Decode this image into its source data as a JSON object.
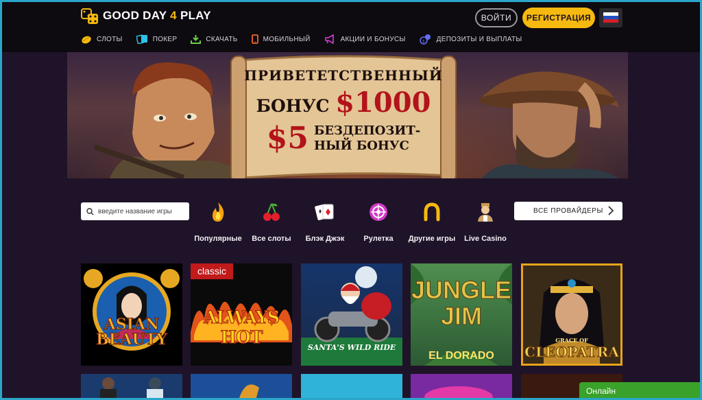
{
  "brand": {
    "name_left": "GOOD DAY",
    "name_num": "4",
    "name_right": "PLAY"
  },
  "header": {
    "login": "ВОЙТИ",
    "register": "РЕГИСТРАЦИЯ",
    "flag": "russia-flag"
  },
  "nav": [
    {
      "label": "СЛОТЫ",
      "icon": "lemon-icon"
    },
    {
      "label": "ПОКЕР",
      "icon": "cards-icon"
    },
    {
      "label": "СКАЧАТЬ",
      "icon": "download-icon"
    },
    {
      "label": "МОБИЛЬНЫЙ",
      "icon": "mobile-icon"
    },
    {
      "label": "АКЦИИ И БОНУСЫ",
      "icon": "megaphone-icon"
    },
    {
      "label": "ДЕПОЗИТЫ И ВЫПЛАТЫ",
      "icon": "coins-icon"
    }
  ],
  "banner": {
    "line1": "ПРИВЕТЕТСТВЕННЫЙ",
    "line2_a": "БОНУС",
    "line2_b": "$1000",
    "line3_a": "$5",
    "line3_b": "БЕЗДЕПОЗИТ-",
    "line3_c": "НЫЙ БОНУС"
  },
  "search": {
    "placeholder": "введите название игры"
  },
  "categories": [
    {
      "label": "Популярные",
      "icon": "flame-icon"
    },
    {
      "label": "Все слоты",
      "icon": "cherry-icon"
    },
    {
      "label": "Блэк Джэк",
      "icon": "playing-cards-icon"
    },
    {
      "label": "Рулетка",
      "icon": "roulette-icon"
    },
    {
      "label": "Другие игры",
      "icon": "horseshoe-icon"
    },
    {
      "label": "Live Casino",
      "icon": "dealer-icon"
    }
  ],
  "providers": {
    "label": "ВСЕ ПРОВАЙДЕРЫ"
  },
  "games": [
    {
      "title": "ASIAN BEAUTY"
    },
    {
      "title": "ALWAYS HOT",
      "badge": "classic"
    },
    {
      "title": "SANTA'S WILD RIDE"
    },
    {
      "title_a": "JUNGLE",
      "title_b": "JIM",
      "title_c": "EL DORADO"
    },
    {
      "title": "CLEOPATRA",
      "sub": "GRACE OF"
    }
  ],
  "chat": {
    "label": "Онлайн"
  },
  "colors": {
    "accent": "#f6b90f",
    "bg": "#1f1329",
    "header": "#0d0a10",
    "online": "#3aa12a"
  }
}
